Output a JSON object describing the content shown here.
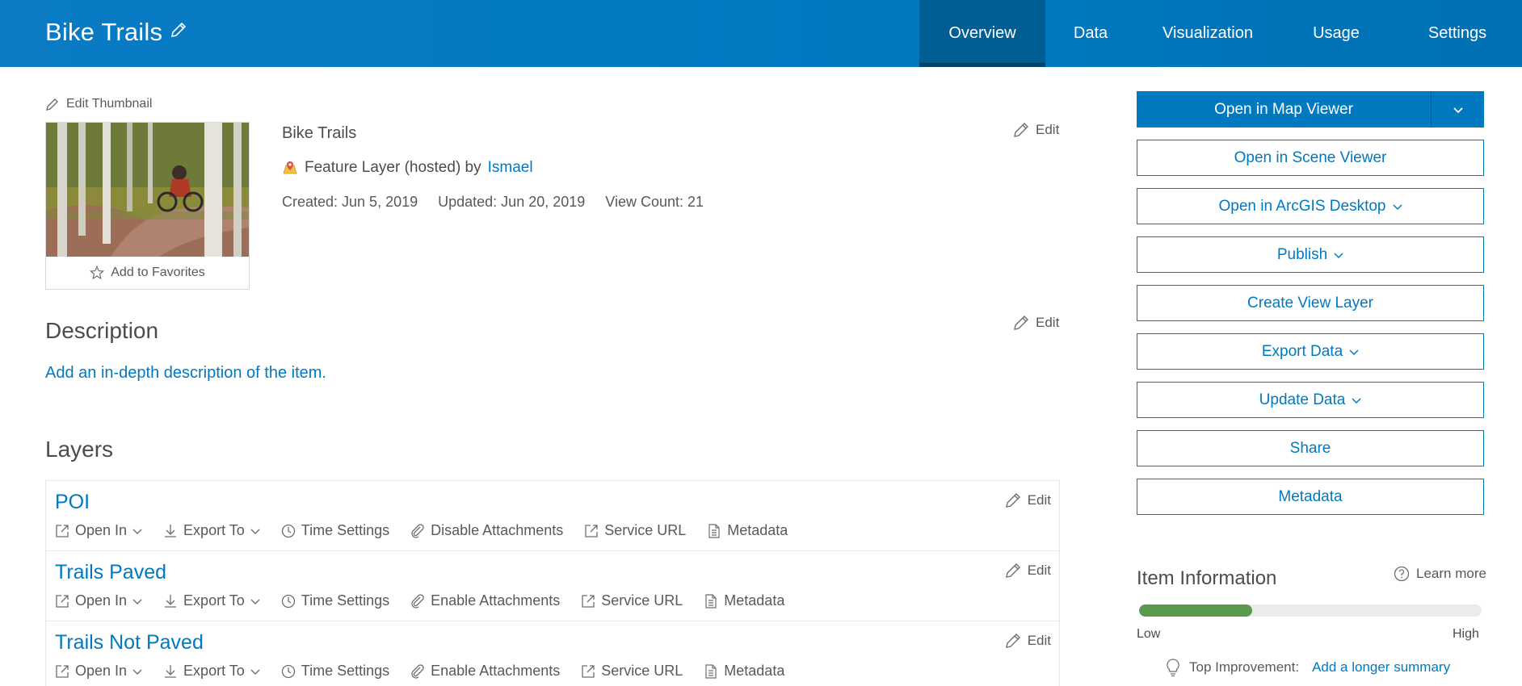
{
  "header": {
    "title": "Bike Trails",
    "tabs": [
      {
        "label": "Overview",
        "active": true
      },
      {
        "label": "Data",
        "active": false
      },
      {
        "label": "Visualization",
        "active": false
      },
      {
        "label": "Usage",
        "active": false
      },
      {
        "label": "Settings",
        "active": false
      }
    ]
  },
  "thumbnail": {
    "edit_label": "Edit Thumbnail",
    "favorites_label": "Add to Favorites"
  },
  "summary": {
    "name": "Bike Trails",
    "type_text": "Feature Layer (hosted) by",
    "owner": "Ismael",
    "created": "Created: Jun 5, 2019",
    "updated": "Updated: Jun 20, 2019",
    "views": "View Count: 21",
    "edit_label": "Edit"
  },
  "description": {
    "title": "Description",
    "edit_label": "Edit",
    "placeholder_link": "Add an in-depth description of the item."
  },
  "layers": {
    "title": "Layers",
    "items": [
      {
        "name": "POI",
        "edit": "Edit",
        "open_in": "Open In",
        "export_to": "Export To",
        "time": "Time Settings",
        "attachments": "Disable Attachments",
        "service_url": "Service URL",
        "metadata": "Metadata"
      },
      {
        "name": "Trails Paved",
        "edit": "Edit",
        "open_in": "Open In",
        "export_to": "Export To",
        "time": "Time Settings",
        "attachments": "Enable Attachments",
        "service_url": "Service URL",
        "metadata": "Metadata"
      },
      {
        "name": "Trails Not Paved",
        "edit": "Edit",
        "open_in": "Open In",
        "export_to": "Export To",
        "time": "Time Settings",
        "attachments": "Enable Attachments",
        "service_url": "Service URL",
        "metadata": "Metadata"
      }
    ]
  },
  "actions": {
    "open_map_viewer": "Open in Map Viewer",
    "open_scene_viewer": "Open in Scene Viewer",
    "open_arcgis_desktop": "Open in ArcGIS Desktop",
    "publish": "Publish",
    "create_view_layer": "Create View Layer",
    "export_data": "Export Data",
    "update_data": "Update Data",
    "share": "Share",
    "metadata": "Metadata"
  },
  "item_information": {
    "title": "Item Information",
    "learn_more": "Learn more",
    "score_fraction": 0.33,
    "low_label": "Low",
    "high_label": "High",
    "top_improvement_label": "Top Improvement:",
    "top_improvement_link": "Add a longer summary"
  },
  "colors": {
    "brand_blue": "#0079c1",
    "active_tab": "#005e95",
    "progress_green": "#5a9a4e"
  }
}
